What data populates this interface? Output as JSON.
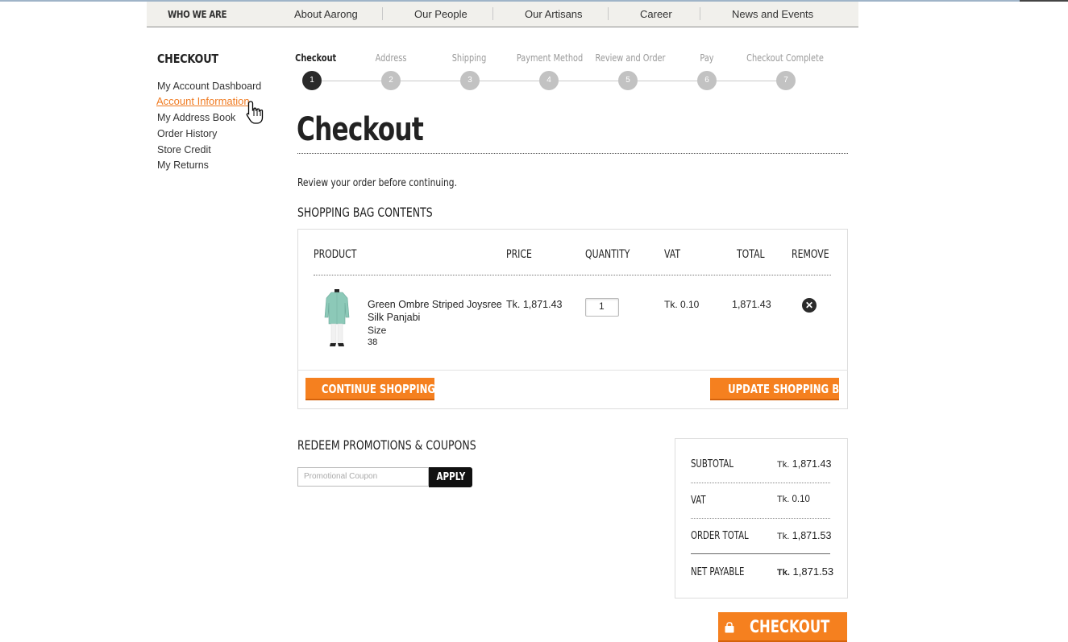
{
  "nav": {
    "brand": "WHO WE ARE",
    "items": [
      "About Aarong",
      "Our People",
      "Our Artisans",
      "Career",
      "News and Events"
    ]
  },
  "sidebar": {
    "title": "CHECKOUT",
    "links": [
      "My Account Dashboard",
      "Account Information",
      "My Address Book",
      "Order History",
      "Store Credit",
      "My Returns"
    ]
  },
  "steps": [
    {
      "label": "Checkout",
      "num": "1"
    },
    {
      "label": "Address",
      "num": "2"
    },
    {
      "label": "Shipping",
      "num": "3"
    },
    {
      "label": "Payment Method",
      "num": "4"
    },
    {
      "label": "Review and Order",
      "num": "5"
    },
    {
      "label": "Pay",
      "num": "6"
    },
    {
      "label": "Checkout Complete",
      "num": "7"
    }
  ],
  "page": {
    "title": "Checkout",
    "note": "Review your order before continuing.",
    "bag_heading": "SHOPPING BAG CONTENTS"
  },
  "cart": {
    "columns": [
      "PRODUCT",
      "PRICE",
      "QUANTITY",
      "VAT",
      "TOTAL",
      "REMOVE"
    ],
    "item": {
      "name_line1": "Green Ombre Striped Joysree",
      "name_line2": "Silk Panjabi",
      "size_label": "Size",
      "size_value": "38",
      "price": "Tk. 1,871.43",
      "quantity": "1",
      "vat": "Tk. 0.10",
      "total": "1,871.43"
    },
    "continue_label": "CONTINUE SHOPPING",
    "update_label": "UPDATE SHOPPING BAG"
  },
  "coupon": {
    "heading": "REDEEM PROMOTIONS & COUPONS",
    "placeholder": "Promotional Coupon",
    "apply_label": "APPLY"
  },
  "totals": {
    "rows": [
      {
        "label": "SUBTOTAL",
        "currency": "Tk.",
        "amount": "1,871.43"
      },
      {
        "label": "VAT",
        "currency": "Tk.",
        "amount": "0.10"
      },
      {
        "label": "ORDER TOTAL",
        "currency": "Tk.",
        "amount": "1,871.53"
      },
      {
        "label": "NET PAYABLE",
        "currency": "Tk.",
        "amount": "1,871.53"
      }
    ],
    "checkout_label": "CHECKOUT"
  },
  "colors": {
    "accent": "#f5801f",
    "active_link": "#f07b22",
    "current_step": "#2a2a2a"
  }
}
